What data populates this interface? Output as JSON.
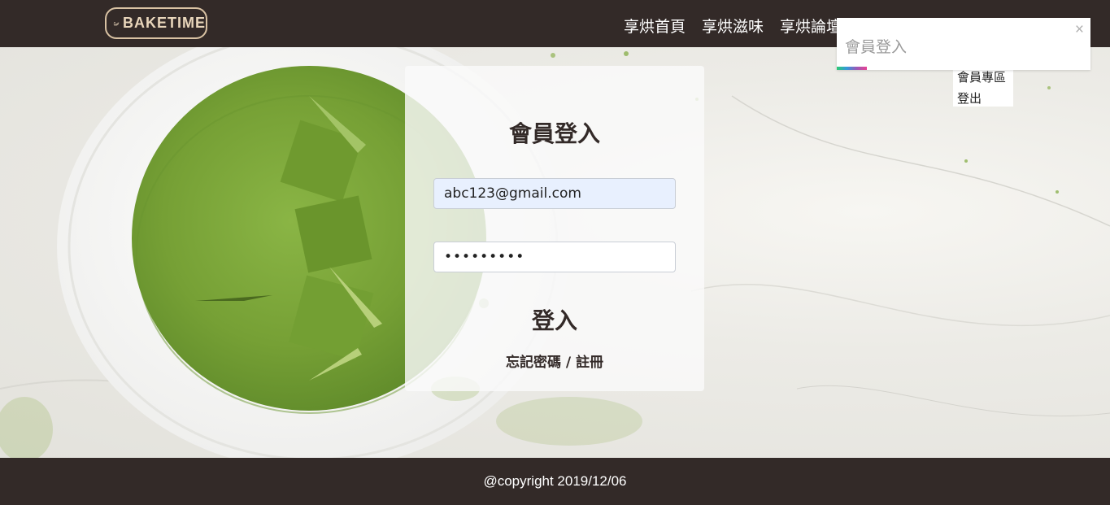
{
  "header": {
    "logo_text": "BAKETIME",
    "nav": [
      {
        "label": "享烘首頁"
      },
      {
        "label": "享烘滋味"
      },
      {
        "label": "享烘論壇"
      }
    ]
  },
  "member_menu": {
    "items": [
      {
        "label": "會員專區"
      },
      {
        "label": "登出"
      }
    ]
  },
  "toast": {
    "message": "會員登入",
    "close_label": "×"
  },
  "login": {
    "title": "會員登入",
    "email_value": "abc123@gmail.com",
    "password_value": "•••••••••",
    "submit_label": "登入",
    "forgot_label": "忘記密碼 / 註冊"
  },
  "footer": {
    "copyright": "@copyright 2019/12/06"
  },
  "colors": {
    "brand_dark": "#332a28",
    "logo_gold": "#d9c2a3",
    "matcha_green": "#7ea83a"
  }
}
